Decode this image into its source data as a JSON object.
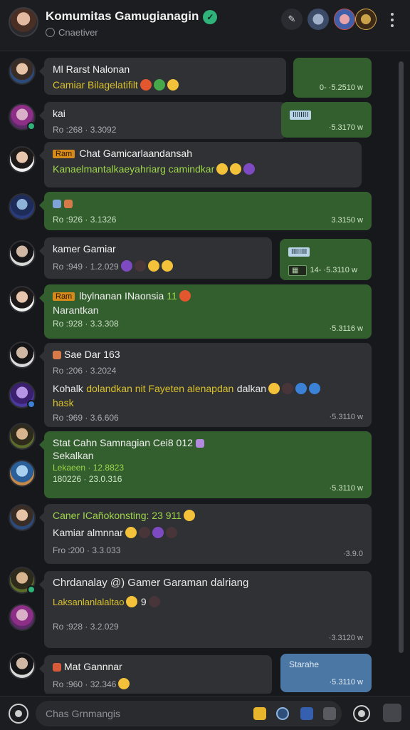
{
  "header": {
    "title": "Komumitas Gamugianagin",
    "subtitle": "Cnaetiver"
  },
  "messages": [
    {
      "left": {
        "name": "Ml Rarst Nalonan",
        "line2": "Camiar Bilagelatifilt"
      },
      "right": {
        "stamp": "0- ·5.2510 w"
      }
    },
    {
      "left": {
        "name": "kai",
        "meta": "Ro :268 · 3.3092"
      },
      "right": {
        "chip": "IIIIIIII",
        "stamp": "·5.3170 w"
      }
    },
    {
      "left": {
        "tag": "Ram",
        "name": "Chat Gamicarlaandansah",
        "line2": "Kanaelmantalkaeyahriarg camindkar"
      }
    },
    {
      "left": {
        "meta": "Ro :926 · 3.1326"
      },
      "right": {
        "stamp": "3.3150 w"
      }
    },
    {
      "left": {
        "name": "kamer Gamiar",
        "meta": "Ro :949 · 1.2.029"
      },
      "right": {
        "chip": "IIIIIIII",
        "chip2": "14- ·5.3110 w"
      }
    },
    {
      "left": {
        "tag": "Ram",
        "name": "lbylnanan INaonsia",
        "suffix": "11",
        "line2": "Narantkan",
        "meta": "Ro :928 · 3.3.308"
      },
      "right": {
        "stamp": "·5.3116 w"
      }
    },
    {
      "left": {
        "name": "Sae Dar 163",
        "meta": "Ro :206 · 3.2024"
      }
    },
    {
      "left": {
        "name": "Kohalk",
        "text": "dolandkan nit Fayeten alenapdan",
        "text2": "dalkan",
        "line2": "hask",
        "meta": "Ro :969 · 3.6.606"
      },
      "right": {
        "stamp": "·5.3110 w"
      }
    },
    {
      "left": {
        "name": "Stat Cahn Samnagian Cei8 012",
        "line2": "Sekalkan",
        "line3": "Lekaeen · 12.8823",
        "meta": "180226 · 23.0.316"
      },
      "right": {
        "stamp": "·5.3110 w"
      }
    },
    {
      "left": {
        "name": "Caner ICañokonsting: 23 911",
        "line2": "Kamiar almnnar",
        "meta": "Fro :200 · 3.3.033"
      },
      "right": {
        "stamp": "·3.9.0"
      }
    },
    {
      "left": {
        "name": "Chrdanalay @) Gamer Garaman dalriang",
        "line2": "Laksanlanlalaltao",
        "line2b": "9",
        "meta": "Ro :928 · 3.2.029"
      },
      "right": {
        "stamp": "·3.3120 w"
      }
    },
    {
      "left": {
        "name": "Mat Gannnar",
        "meta": "Ro :960 · 32.346"
      },
      "right": {
        "label": "Starahe",
        "stamp": "·5.3110 w"
      }
    }
  ],
  "composer": {
    "placeholder": "Chas Grnmangis"
  }
}
